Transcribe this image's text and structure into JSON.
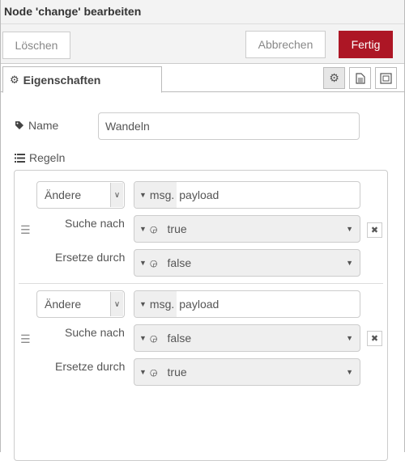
{
  "header": {
    "title": "Node 'change' bearbeiten"
  },
  "toolbar": {
    "delete_label": "Löschen",
    "cancel_label": "Abbrechen",
    "done_label": "Fertig",
    "done_color": "#ad1625"
  },
  "tabs": {
    "properties_label": "Eigenschaften"
  },
  "form": {
    "name_label": "Name",
    "name_value": "Wandeln",
    "rules_label": "Regeln",
    "rules": [
      {
        "action": "Ändere",
        "target_prefix": "msg.",
        "target_value": "payload",
        "search_label": "Suche nach",
        "search_value": "true",
        "replace_label": "Ersetze durch",
        "replace_value": "false"
      },
      {
        "action": "Ändere",
        "target_prefix": "msg.",
        "target_value": "payload",
        "search_label": "Suche nach",
        "search_value": "false",
        "replace_label": "Ersetze durch",
        "replace_value": "true"
      }
    ]
  },
  "icons": {
    "tab": "gear-icon",
    "name": "tag-icon",
    "rules": "list-icon",
    "handle": "drag-handle-icon",
    "remove": "close-icon",
    "type": "boolean-icon"
  }
}
